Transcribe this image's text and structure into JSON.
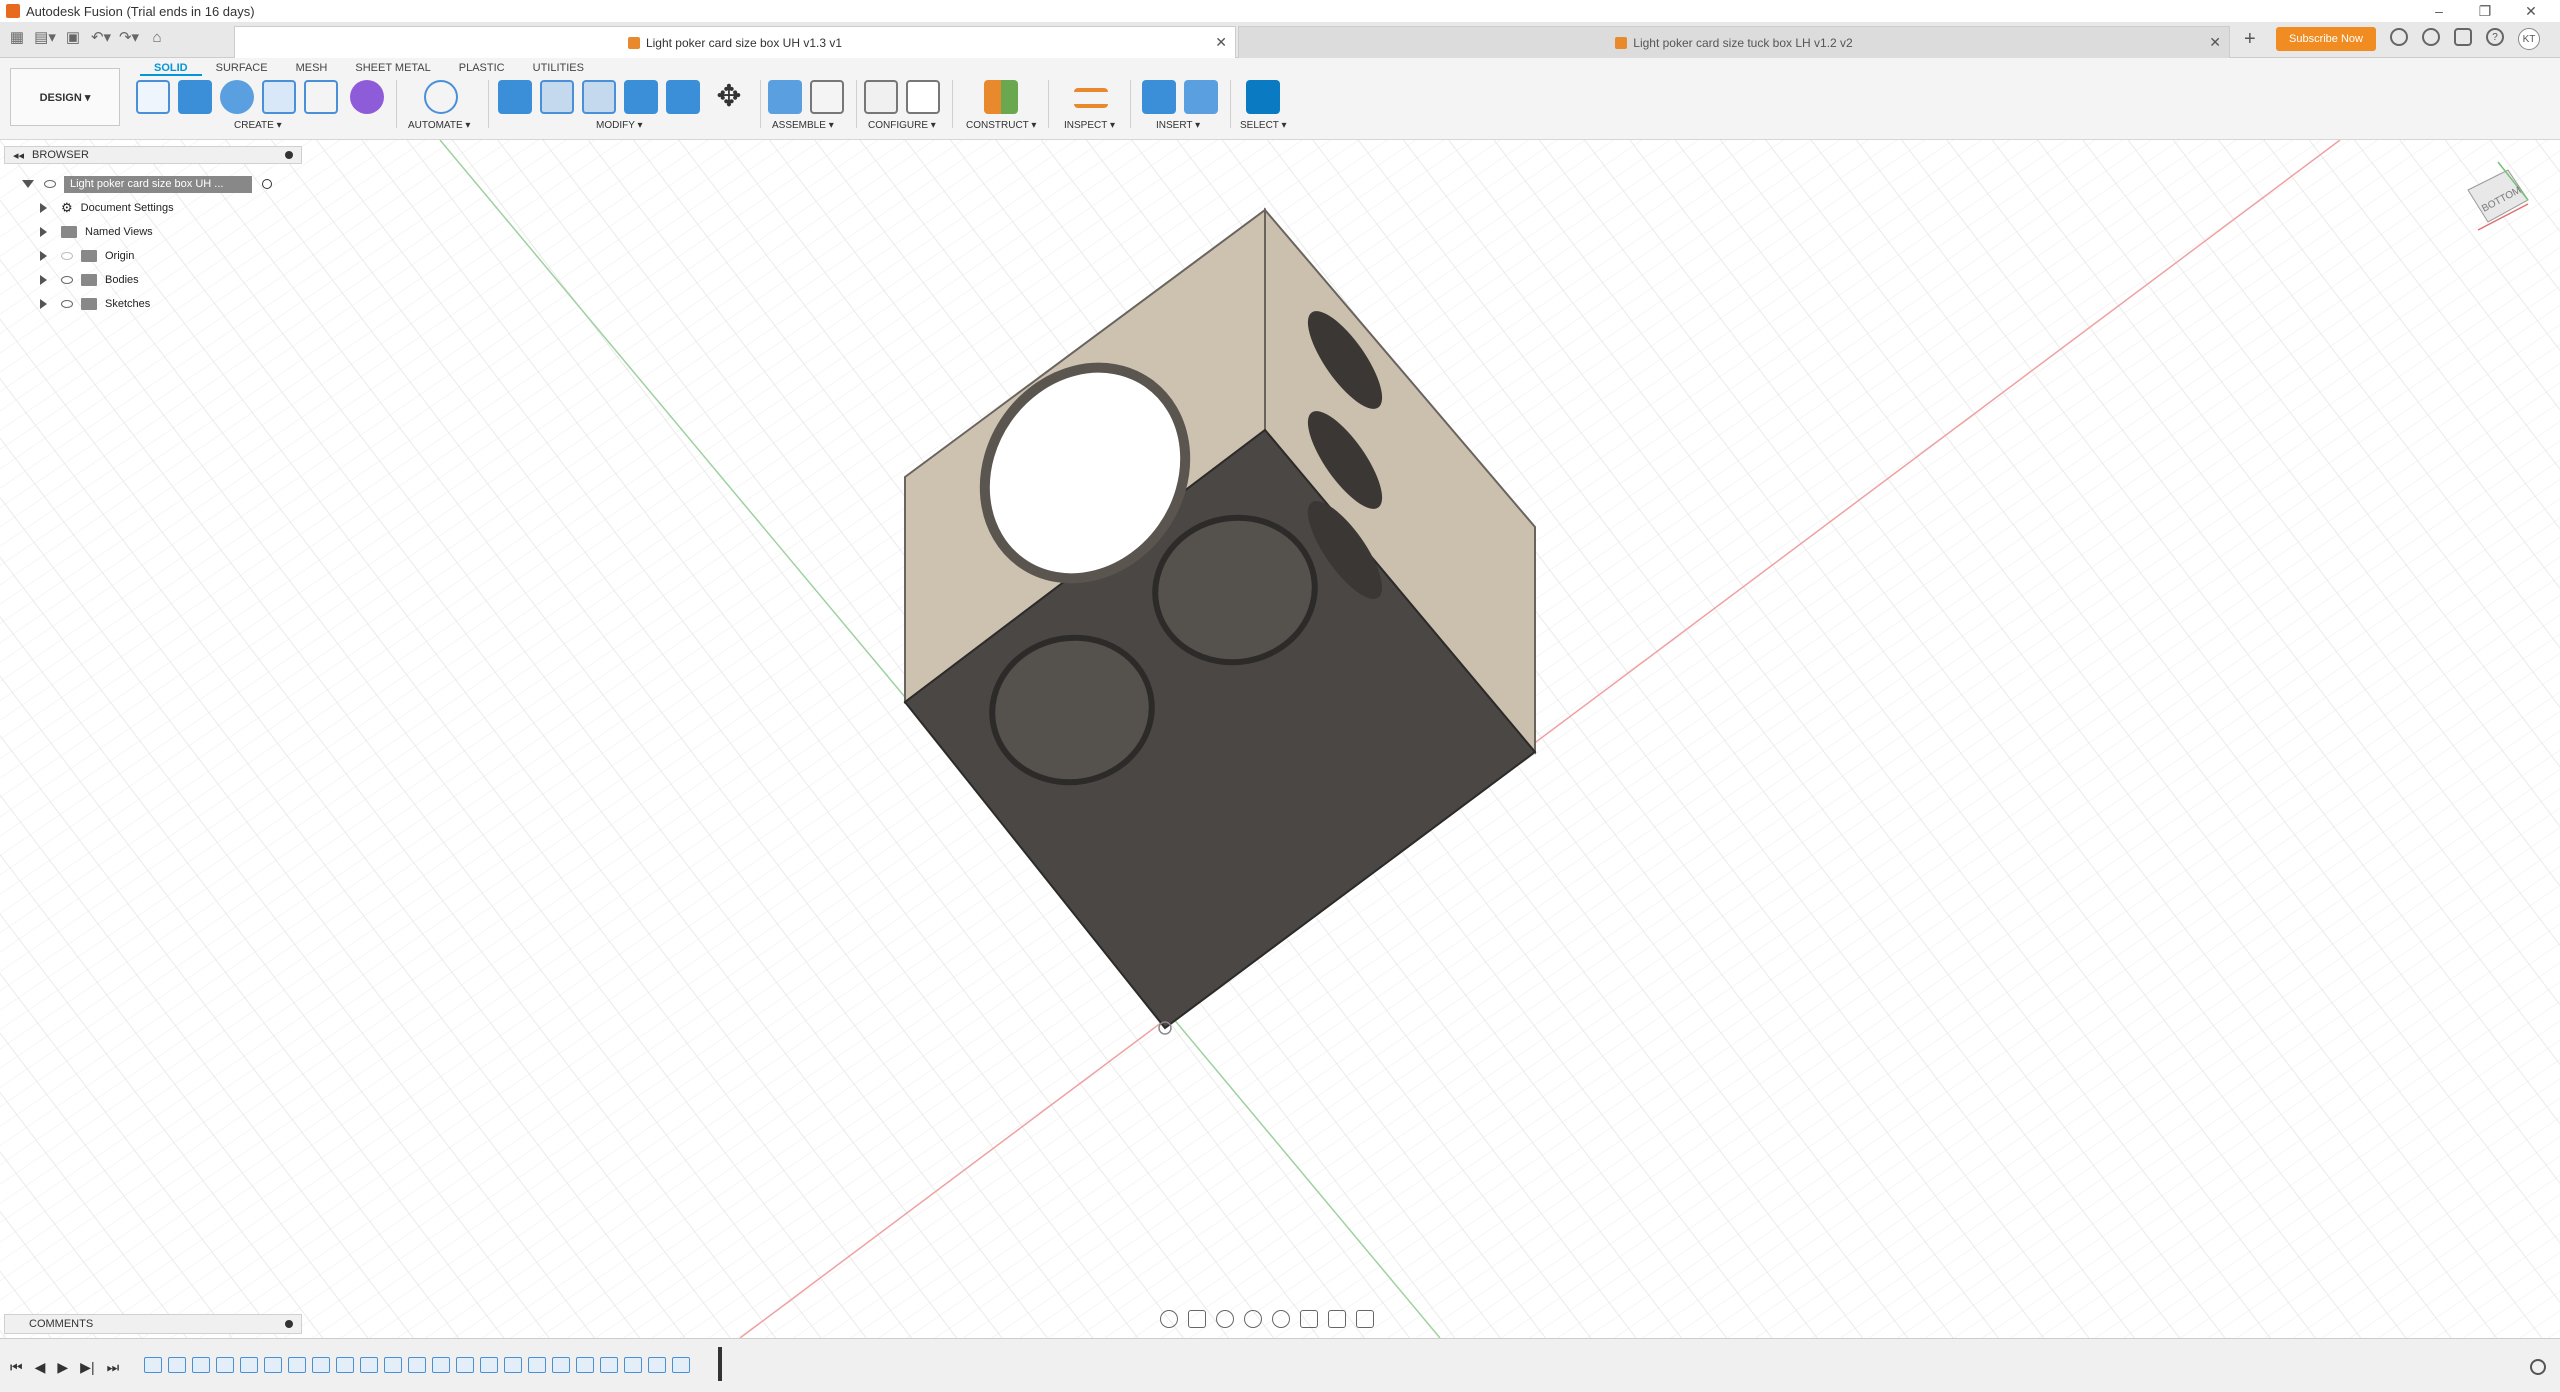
{
  "titlebar": {
    "title": "Autodesk Fusion (Trial ends in 16 days)"
  },
  "tabs": [
    {
      "label": "Light poker card size box UH v1.3 v1"
    },
    {
      "label": "Light poker card size tuck box LH v1.2 v2"
    }
  ],
  "header": {
    "subscribe_label": "Subscribe Now",
    "avatar_initials": "KT"
  },
  "ribbon": {
    "workspace": "DESIGN ▾",
    "tabs": [
      "SOLID",
      "SURFACE",
      "MESH",
      "SHEET METAL",
      "PLASTIC",
      "UTILITIES"
    ],
    "groups": [
      "CREATE ▾",
      "AUTOMATE ▾",
      "MODIFY ▾",
      "ASSEMBLE ▾",
      "CONFIGURE ▾",
      "CONSTRUCT ▾",
      "INSPECT ▾",
      "INSERT ▾",
      "SELECT ▾"
    ]
  },
  "browser": {
    "title": "BROWSER",
    "root": "Light poker card size box UH ...",
    "items": [
      "Document Settings",
      "Named Views",
      "Origin",
      "Bodies",
      "Sketches"
    ]
  },
  "viewcube": {
    "face_label": "BOTTOM"
  },
  "comments": {
    "title": "COMMENTS"
  },
  "colors": {
    "accent": "#0696d7",
    "subscribe": "#f08c21",
    "body_dark": "#4a4744",
    "body_light": "#cbbfae"
  }
}
